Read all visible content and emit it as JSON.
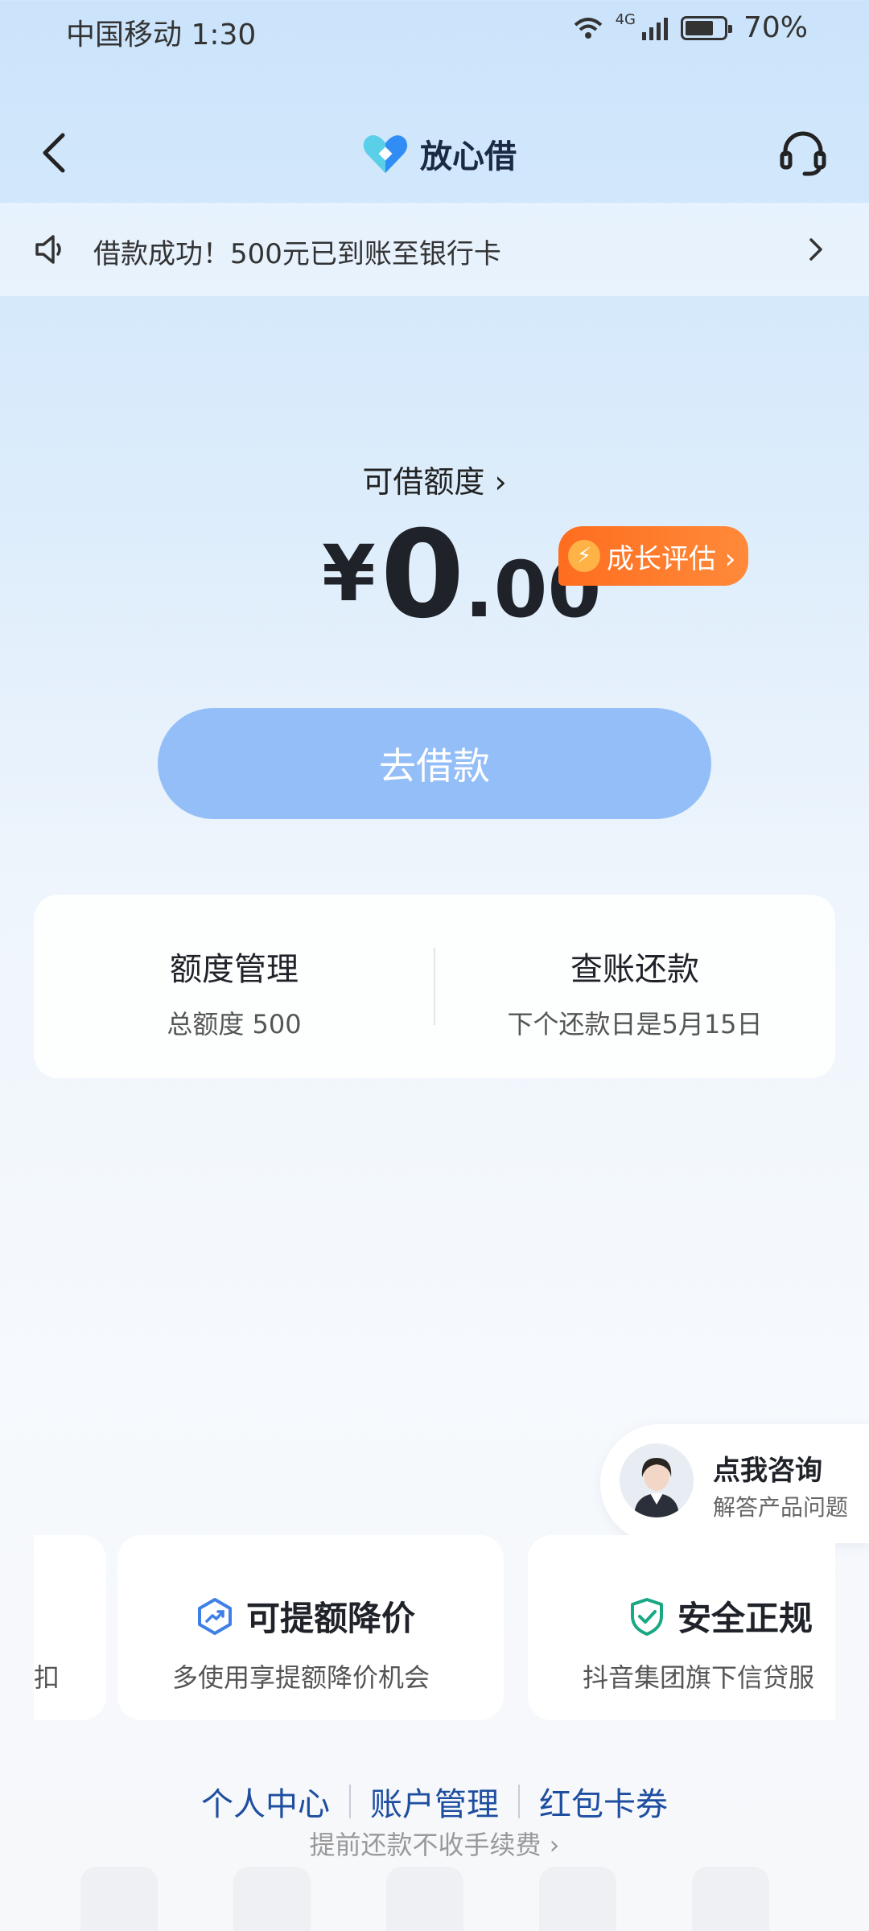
{
  "status_bar": {
    "carrier_time": "中国移动 1:30",
    "network": "4G",
    "battery": "70%"
  },
  "nav": {
    "app_name": "放心借"
  },
  "notice": {
    "text": "借款成功！500元已到账至银行卡"
  },
  "quota": {
    "label": "可借额度 ›",
    "yen": "¥",
    "integer": "0",
    "decimal": ".00",
    "growth_badge": "成长评估 ›"
  },
  "borrow_button": "去借款",
  "summary_card": {
    "left_title": "额度管理",
    "left_sub": "总额度 500",
    "right_title": "查账还款",
    "right_sub": "下个还款日是5月15日"
  },
  "consult": {
    "title": "点我咨询",
    "subtitle": "解答产品问题"
  },
  "features": {
    "partial_left": "扣",
    "item1_title": "可提额降价",
    "item1_desc": "多使用享提额降价机会",
    "item2_title": "安全正规",
    "item2_desc": "抖音集团旗下信贷服"
  },
  "footer": {
    "link1": "个人中心",
    "link2": "账户管理",
    "link3": "红包卡券",
    "prepay": "提前还款不收手续费 ›"
  },
  "colors": {
    "accent": "#94bef8",
    "badge": "#ff6d1f",
    "link": "#1d4ea0",
    "safe_icon": "#19a784",
    "chart_icon": "#3f7fe6"
  }
}
